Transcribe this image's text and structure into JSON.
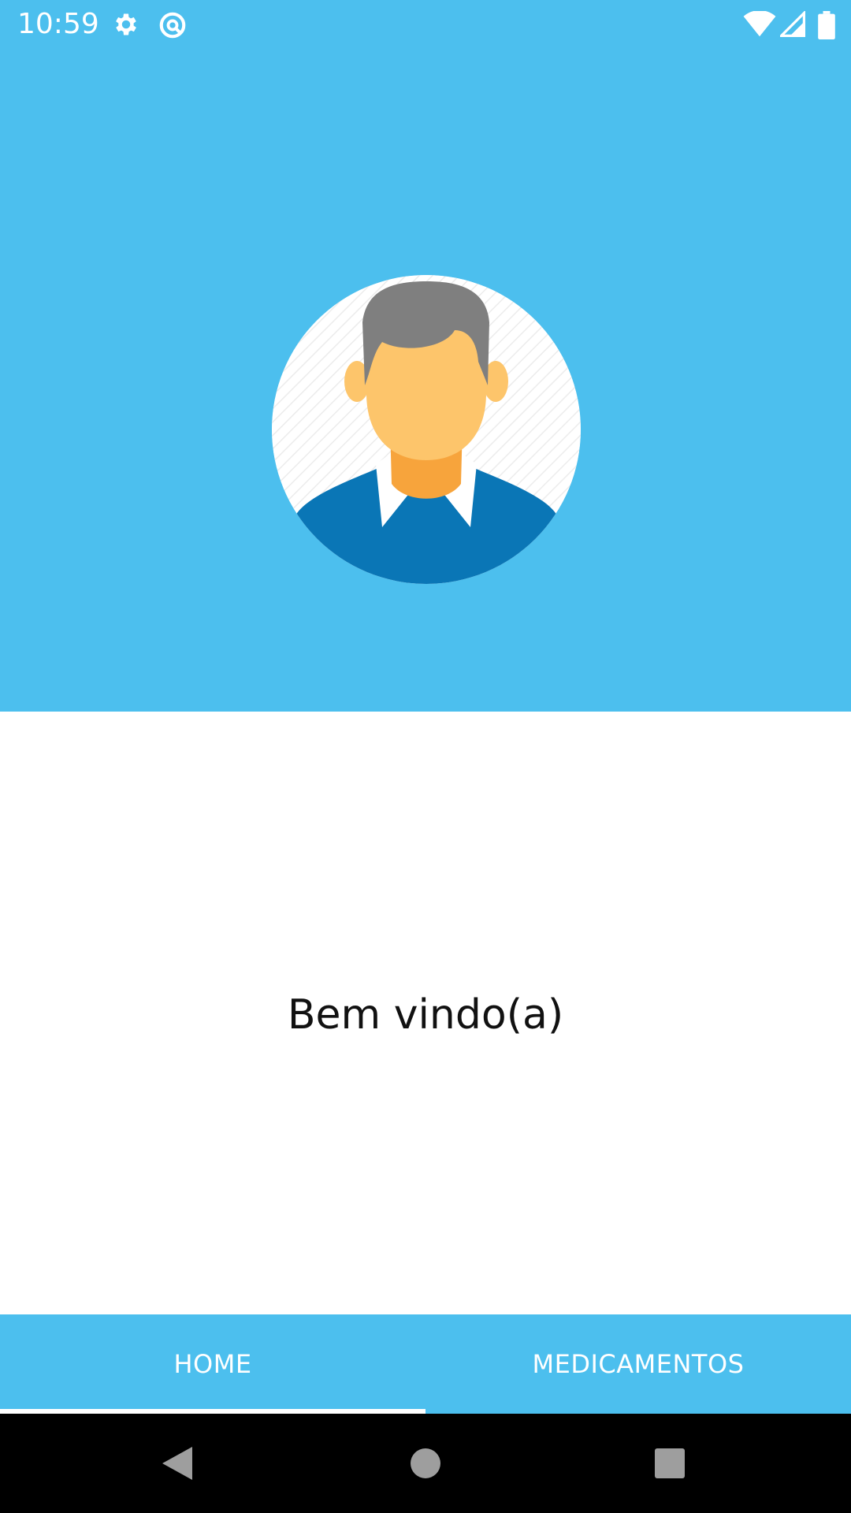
{
  "status_bar": {
    "time": "10:59",
    "icons": [
      "gear-icon",
      "data-saver-icon",
      "wifi-icon",
      "signal-icon",
      "battery-icon"
    ]
  },
  "header": {
    "background_color": "#4CBFEE",
    "avatar": "male-user-avatar"
  },
  "main": {
    "welcome_text": "Bem vindo(a)"
  },
  "tabs": [
    {
      "label": "HOME",
      "selected": true
    },
    {
      "label": "MEDICAMENTOS",
      "selected": false
    }
  ],
  "nav_bar": {
    "buttons": [
      "back-icon",
      "home-icon",
      "recents-icon"
    ]
  }
}
